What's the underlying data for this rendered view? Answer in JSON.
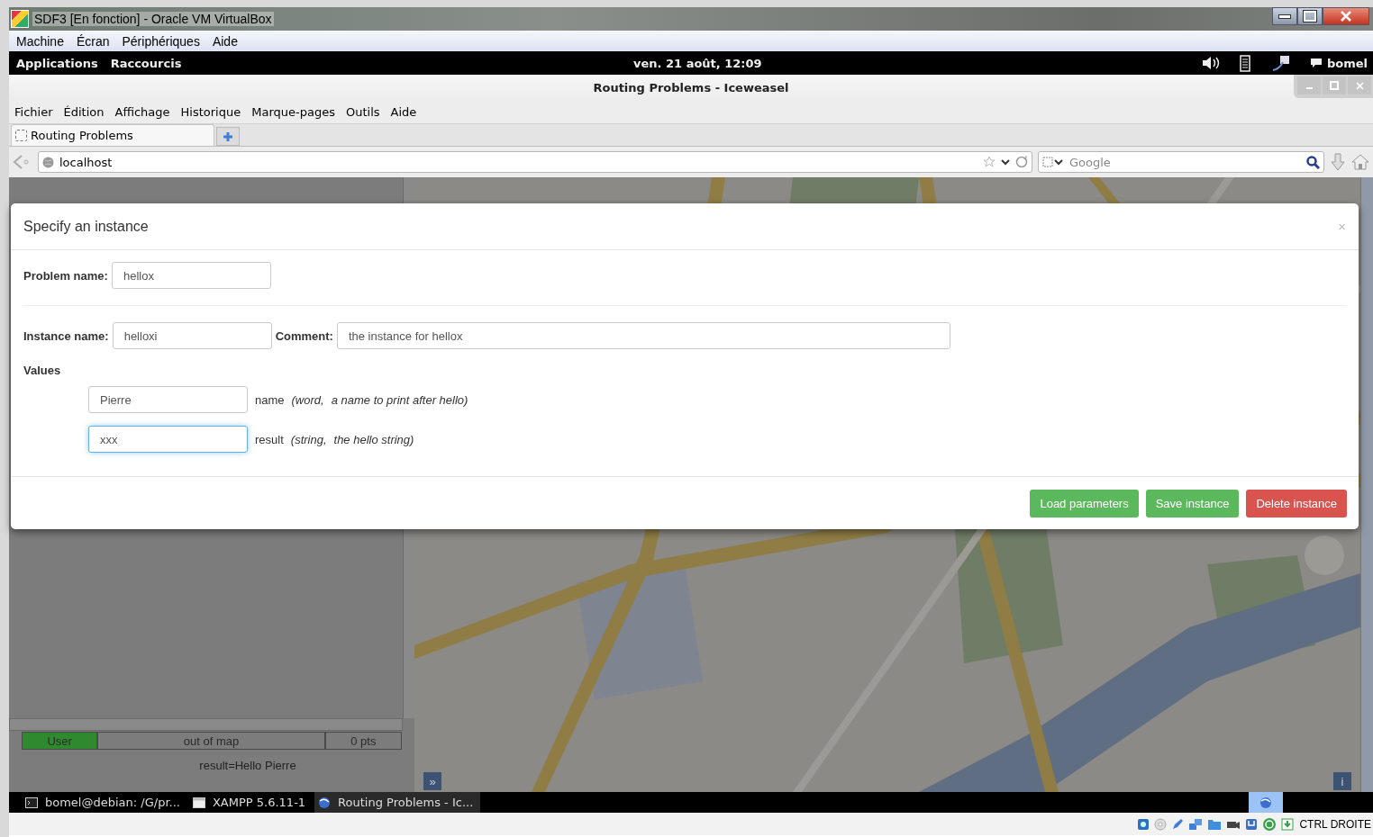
{
  "vm_window": {
    "title": "SDF3 [En fonction] - Oracle VM VirtualBox",
    "menu": [
      "Machine",
      "Écran",
      "Périphériques",
      "Aide"
    ]
  },
  "top_bar": {
    "menus": [
      "Applications",
      "Raccourcis"
    ],
    "clock": "ven. 21 août, 12:09",
    "user": "bomel"
  },
  "browser": {
    "title": "Routing Problems - Iceweasel",
    "menu": [
      {
        "label": "Fichier"
      },
      {
        "label": "Édition"
      },
      {
        "label": "Affichage"
      },
      {
        "label": "Historique"
      },
      {
        "label": "Marque-pages"
      },
      {
        "label": "Outils"
      },
      {
        "label": "Aide"
      }
    ],
    "tabs": [
      {
        "label": "Routing Problems",
        "selected": true
      }
    ],
    "url": "localhost",
    "search_placeholder": "Google"
  },
  "page": {
    "status": {
      "user": "User",
      "position": "out of map",
      "score": "0 pts"
    },
    "result": "result=Hello Pierre",
    "map_controls": {
      "expand": "»",
      "info": "i"
    }
  },
  "dialog": {
    "title": "Specify an instance",
    "close": "×",
    "problem_label": "Problem name:",
    "problem_value": "hellox",
    "instance_label": "Instance name:",
    "instance_value": "helloxi",
    "comment_label": "Comment:",
    "comment_value": "the instance for hellox",
    "values_heading": "Values",
    "values": [
      {
        "value": "Pierre",
        "name": "name",
        "type": "(word,",
        "description": "a name to print after hello)",
        "focused": false
      },
      {
        "value": "xxx",
        "name": "result",
        "type": "(string,",
        "description": "the hello string)",
        "focused": true
      }
    ],
    "buttons": [
      {
        "label": "Load parameters",
        "kind": "success"
      },
      {
        "label": "Save instance",
        "kind": "success"
      },
      {
        "label": "Delete instance",
        "kind": "danger"
      }
    ]
  },
  "taskbar": [
    {
      "label": "bomel@debian: /G/pr...",
      "kind": "terminal",
      "selected": false
    },
    {
      "label": "XAMPP 5.6.11-1",
      "kind": "window",
      "selected": false
    },
    {
      "label": "Routing Problems - Ic...",
      "kind": "browser",
      "selected": true
    }
  ],
  "vm_status": {
    "host_key": "CTRL DROITE"
  }
}
